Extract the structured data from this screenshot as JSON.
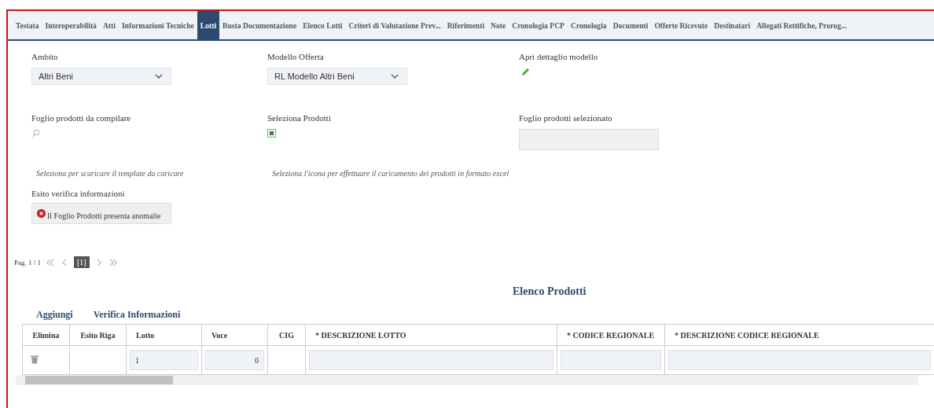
{
  "tabs": [
    {
      "label": "Testata",
      "selected": false
    },
    {
      "label": "Interoperabilità",
      "selected": false
    },
    {
      "label": "Atti",
      "selected": false
    },
    {
      "label": "Informazioni Tecniche",
      "selected": false
    },
    {
      "label": "Lotti",
      "selected": true
    },
    {
      "label": "Busta Documentazione",
      "selected": false
    },
    {
      "label": "Elenco Lotti",
      "selected": false
    },
    {
      "label": "Criteri di Valutazione Prev...",
      "selected": false
    },
    {
      "label": "Riferimenti",
      "selected": false
    },
    {
      "label": "Note",
      "selected": false
    },
    {
      "label": "Cronologia PCP",
      "selected": false
    },
    {
      "label": "Cronologia",
      "selected": false
    },
    {
      "label": "Documenti",
      "selected": false
    },
    {
      "label": "Offerte Ricevute",
      "selected": false
    },
    {
      "label": "Destinatari",
      "selected": false
    },
    {
      "label": "Allegati Rettifiche, Prorog...",
      "selected": false
    }
  ],
  "form_rows": [
    [
      {
        "kind": "select",
        "label": "Ambito",
        "value": "Altri Beni"
      },
      {
        "kind": "select",
        "label": "Modello Offerta",
        "value": "RL Modello Altri Beni"
      },
      {
        "kind": "edit",
        "label": "Apri dettaglio modello"
      }
    ],
    [
      {
        "kind": "search",
        "label": "Foglio prodotti da compilare",
        "hint": "Seleziona per scaricare il template da caricare"
      },
      {
        "kind": "excel",
        "label": "Seleziona Prodotti",
        "hint": "Seleziona l'icona per effettuare il caricamento dei prodotti in formato excel"
      },
      {
        "kind": "field",
        "label": "Foglio prodotti selezionato"
      }
    ]
  ],
  "esito": {
    "label": "Esito verifica informazioni",
    "message": "Il Foglio Prodotti presenta anomalie"
  },
  "pagination": {
    "label": "Pag. 1 / 1",
    "current": "[1]"
  },
  "section_title": "Elenco Prodotti",
  "actions": [
    "Aggiungi",
    "Verifica Informazioni"
  ],
  "table": {
    "columns": [
      "Elimina",
      "Esito Riga",
      "Lotto",
      "Voce",
      "CIG",
      "* DESCRIZIONE LOTTO",
      "* CODICE REGIONALE",
      "* DESCRIZIONE CODICE REGIONALE"
    ],
    "rows": [
      [
        {
          "kind": "delete"
        },
        {
          "kind": "empty"
        },
        {
          "kind": "input",
          "value": "1"
        },
        {
          "kind": "number",
          "value": "0"
        },
        {
          "kind": "empty"
        },
        {
          "kind": "input"
        },
        {
          "kind": "input"
        },
        {
          "kind": "input"
        }
      ]
    ]
  }
}
